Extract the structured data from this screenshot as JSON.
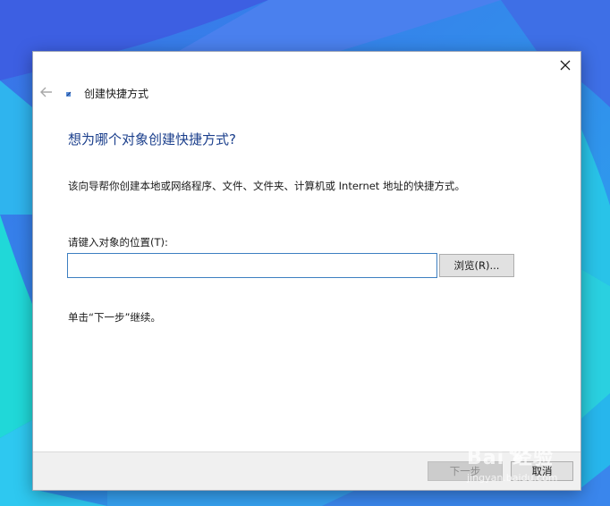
{
  "dialog": {
    "title": "创建快捷方式",
    "heading": "想为哪个对象创建快捷方式?",
    "description": "该向导帮你创建本地或网络程序、文件、文件夹、计算机或 Internet 地址的快捷方式。",
    "location_label": "请键入对象的位置(T):",
    "location_value": "",
    "browse_label": "浏览(R)...",
    "hint": "单击“下一步”继续。"
  },
  "footer": {
    "next_label": "下一步",
    "cancel_label": "取消"
  },
  "watermark": {
    "brand": "Bai 经验",
    "url": "jingyan.baidu.com"
  },
  "icons": {
    "close": "close-icon",
    "back": "back-arrow-icon",
    "wizard": "shortcut-wizard-icon"
  },
  "colors": {
    "heading": "#1b3f8c",
    "input_border": "#3d7fc1",
    "desktop_blue": "#2f8fe6",
    "desktop_teal": "#22d4d8"
  }
}
